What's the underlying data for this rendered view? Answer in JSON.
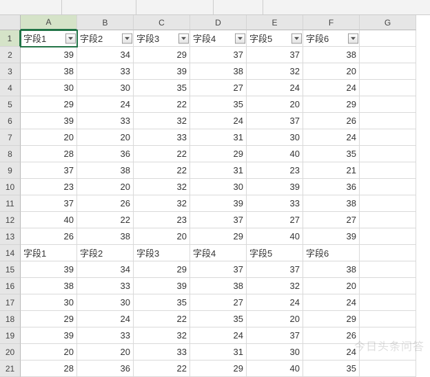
{
  "columns": [
    "A",
    "B",
    "C",
    "D",
    "E",
    "F",
    "G"
  ],
  "headerRow": [
    "字段1",
    "字段2",
    "字段3",
    "字段4",
    "字段5",
    "字段6"
  ],
  "selectedCell": "A1",
  "watermark": "今日头条问答",
  "rows": [
    {
      "r": 1,
      "type": "header",
      "cells": [
        "字段1",
        "字段2",
        "字段3",
        "字段4",
        "字段5",
        "字段6"
      ],
      "filter": true
    },
    {
      "r": 2,
      "type": "num",
      "cells": [
        39,
        34,
        29,
        37,
        37,
        38
      ]
    },
    {
      "r": 3,
      "type": "num",
      "cells": [
        38,
        33,
        39,
        38,
        32,
        20
      ]
    },
    {
      "r": 4,
      "type": "num",
      "cells": [
        30,
        30,
        35,
        27,
        24,
        24
      ]
    },
    {
      "r": 5,
      "type": "num",
      "cells": [
        29,
        24,
        22,
        35,
        20,
        29
      ]
    },
    {
      "r": 6,
      "type": "num",
      "cells": [
        39,
        33,
        32,
        24,
        37,
        26
      ]
    },
    {
      "r": 7,
      "type": "num",
      "cells": [
        20,
        20,
        33,
        31,
        30,
        24
      ]
    },
    {
      "r": 8,
      "type": "num",
      "cells": [
        28,
        36,
        22,
        29,
        40,
        35
      ]
    },
    {
      "r": 9,
      "type": "num",
      "cells": [
        37,
        38,
        22,
        31,
        23,
        21
      ]
    },
    {
      "r": 10,
      "type": "num",
      "cells": [
        23,
        20,
        32,
        30,
        39,
        36
      ]
    },
    {
      "r": 11,
      "type": "num",
      "cells": [
        37,
        26,
        32,
        39,
        33,
        38
      ]
    },
    {
      "r": 12,
      "type": "num",
      "cells": [
        40,
        22,
        23,
        37,
        27,
        27
      ]
    },
    {
      "r": 13,
      "type": "num",
      "cells": [
        26,
        38,
        20,
        29,
        40,
        39
      ]
    },
    {
      "r": 14,
      "type": "header",
      "cells": [
        "字段1",
        "字段2",
        "字段3",
        "字段4",
        "字段5",
        "字段6"
      ],
      "filter": false
    },
    {
      "r": 15,
      "type": "num",
      "cells": [
        39,
        34,
        29,
        37,
        37,
        38
      ]
    },
    {
      "r": 16,
      "type": "num",
      "cells": [
        38,
        33,
        39,
        38,
        32,
        20
      ]
    },
    {
      "r": 17,
      "type": "num",
      "cells": [
        30,
        30,
        35,
        27,
        24,
        24
      ]
    },
    {
      "r": 18,
      "type": "num",
      "cells": [
        29,
        24,
        22,
        35,
        20,
        29
      ]
    },
    {
      "r": 19,
      "type": "num",
      "cells": [
        39,
        33,
        32,
        24,
        37,
        26
      ]
    },
    {
      "r": 20,
      "type": "num",
      "cells": [
        20,
        20,
        33,
        31,
        30,
        24
      ]
    },
    {
      "r": 21,
      "type": "num",
      "cells": [
        28,
        36,
        22,
        29,
        40,
        35
      ]
    }
  ]
}
